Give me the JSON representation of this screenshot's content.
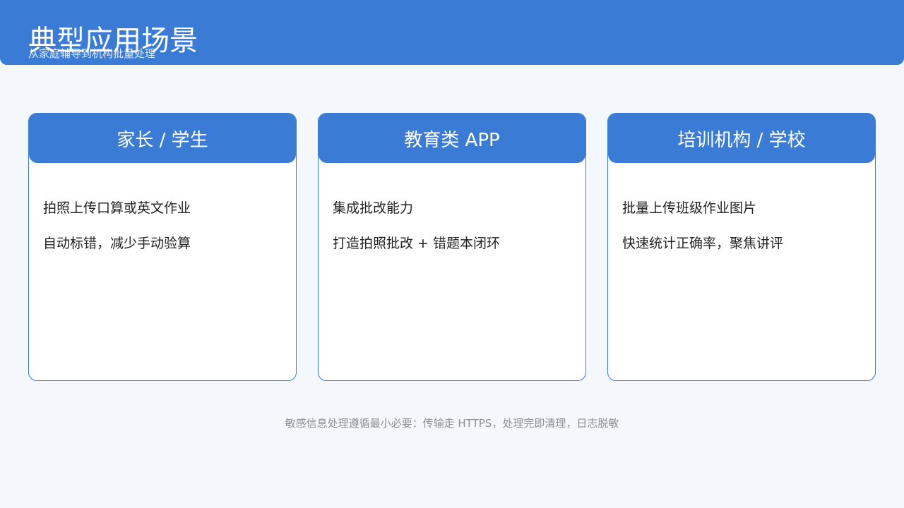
{
  "header": {
    "title": "典型应用场景",
    "subtitle": "从家庭辅导到机构批量处理"
  },
  "cards": [
    {
      "title": "家长 / 学生",
      "lines": [
        "拍照上传口算或英文作业",
        "自动标错，减少手动验算"
      ]
    },
    {
      "title": "教育类 APP",
      "lines": [
        "集成批改能力",
        "打造拍照批改 + 错题本闭环"
      ]
    },
    {
      "title": "培训机构 / 学校",
      "lines": [
        "批量上传班级作业图片",
        "快速统计正确率，聚焦讲评"
      ]
    }
  ],
  "footer": {
    "note": "敏感信息处理遵循最小必要：传输走 HTTPS，处理完即清理，日志脱敏"
  },
  "colors": {
    "accent": "#3a7bd5",
    "background": "#f4f8fc",
    "footer_text": "#8a8f99"
  }
}
